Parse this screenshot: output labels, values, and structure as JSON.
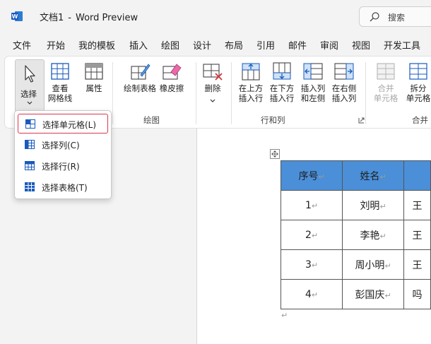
{
  "titlebar": {
    "doc_name": "文档1",
    "separator": "-",
    "app_name": "Word Preview",
    "search_placeholder": "搜索"
  },
  "menu": {
    "tabs": [
      "文件",
      "开始",
      "我的模板",
      "插入",
      "绘图",
      "设计",
      "布局",
      "引用",
      "邮件",
      "审阅",
      "视图",
      "开发工具"
    ]
  },
  "ribbon": {
    "select_label": "选择",
    "view_gridlines_line1": "查看",
    "view_gridlines_line2": "网格线",
    "properties_label": "属性",
    "draw_table_label": "绘制表格",
    "eraser_label": "橡皮擦",
    "delete_label": "删除",
    "insert_above_line1": "在上方",
    "insert_above_line2": "插入行",
    "insert_below_line1": "在下方",
    "insert_below_line2": "插入行",
    "insert_left_line1": "插入列",
    "insert_left_line2": "和左侧",
    "insert_right_line1": "在右侧",
    "insert_right_line2": "插入列",
    "merge_cells_line1": "合并",
    "merge_cells_line2": "单元格",
    "split_cells_line1": "拆分",
    "split_cells_line2": "单元格",
    "group_draw": "绘图",
    "group_rows_cols": "行和列",
    "group_merge": "合并"
  },
  "dropdown": {
    "items": [
      "选择单元格(L)",
      "选择列(C)",
      "选择行(R)",
      "选择表格(T)"
    ]
  },
  "table": {
    "headers": [
      "序号",
      "姓名"
    ],
    "rows": [
      [
        "1",
        "刘明"
      ],
      [
        "2",
        "李艳"
      ],
      [
        "3",
        "周小明"
      ],
      [
        "4",
        "彭国庆"
      ]
    ],
    "partial_col": [
      "王",
      "王",
      "王",
      "吗"
    ],
    "para_mark": "↵",
    "header_color": "#4a8fd8"
  },
  "colors": {
    "accent": "#185abd",
    "highlight_border": "#d9364f"
  }
}
